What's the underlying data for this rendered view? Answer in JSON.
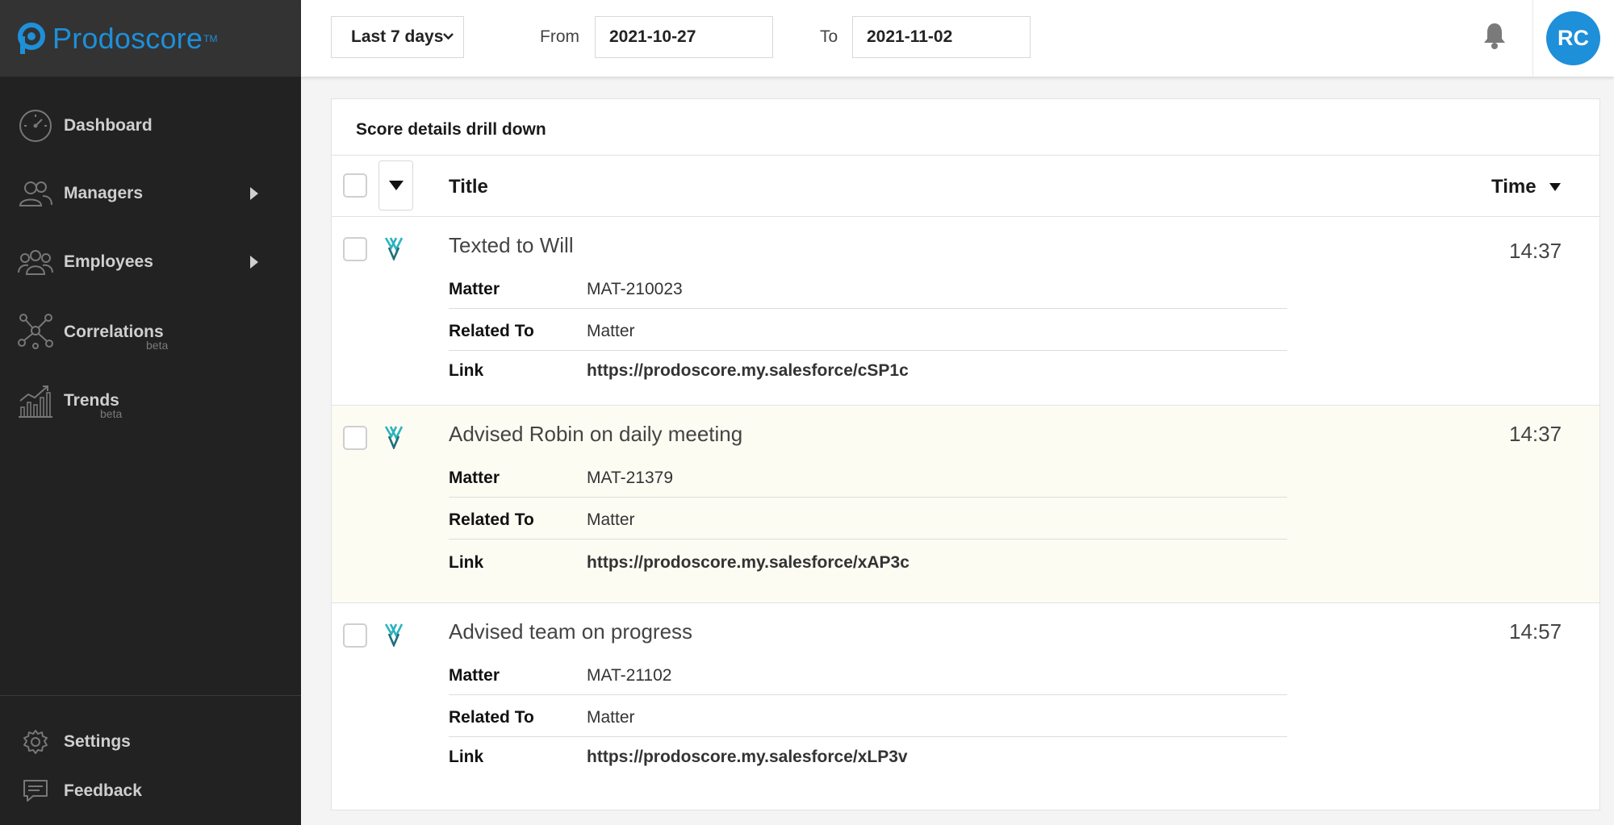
{
  "brand": {
    "name": "Prodoscore",
    "trademark": "TM"
  },
  "sidebar": {
    "items": [
      {
        "label": "Dashboard",
        "icon": "gauge-icon",
        "has_submenu": false,
        "badge": ""
      },
      {
        "label": "Managers",
        "icon": "users-icon",
        "has_submenu": true,
        "badge": ""
      },
      {
        "label": "Employees",
        "icon": "group-icon",
        "has_submenu": true,
        "badge": ""
      },
      {
        "label": "Correlations",
        "icon": "network-icon",
        "has_submenu": false,
        "badge": "beta"
      },
      {
        "label": "Trends",
        "icon": "bar-trend-icon",
        "has_submenu": false,
        "badge": "beta"
      }
    ],
    "bottom_items": [
      {
        "label": "Settings",
        "icon": "gear-icon"
      },
      {
        "label": "Feedback",
        "icon": "chat-icon"
      }
    ]
  },
  "header": {
    "range_select": "Last 7 days",
    "from_label": "From",
    "from_value": "2021-10-27",
    "to_label": "To",
    "to_value": "2021-11-02",
    "user_initials": "RC"
  },
  "panel": {
    "title": "Score details drill down",
    "columns": {
      "title": "Title",
      "time": "Time"
    },
    "rows": [
      {
        "title": "Texted to Will",
        "time": "14:37",
        "highlighted": false,
        "details": [
          {
            "key": "Matter",
            "value": "MAT-210023"
          },
          {
            "key": "Related To",
            "value": "Matter"
          },
          {
            "key": "Link",
            "value": "https://prodoscore.my.salesforce/cSP1c"
          }
        ]
      },
      {
        "title": "Advised Robin on daily meeting",
        "time": "14:37",
        "highlighted": true,
        "details": [
          {
            "key": "Matter",
            "value": "MAT-21379"
          },
          {
            "key": "Related To",
            "value": "Matter"
          },
          {
            "key": "Link",
            "value": "https://prodoscore.my.salesforce/xAP3c"
          }
        ]
      },
      {
        "title": "Advised team on progress",
        "time": "14:57",
        "highlighted": false,
        "details": [
          {
            "key": "Matter",
            "value": "MAT-21102"
          },
          {
            "key": "Related To",
            "value": "Matter"
          },
          {
            "key": "Link",
            "value": "https://prodoscore.my.salesforce/xLP3v"
          }
        ]
      }
    ]
  },
  "colors": {
    "brand": "#1e8fd9",
    "sidebar_bg": "#222222",
    "logo_bar_bg": "#333333",
    "row_highlight": "#fdfcf3",
    "source_icon": "#2bb3c0"
  }
}
